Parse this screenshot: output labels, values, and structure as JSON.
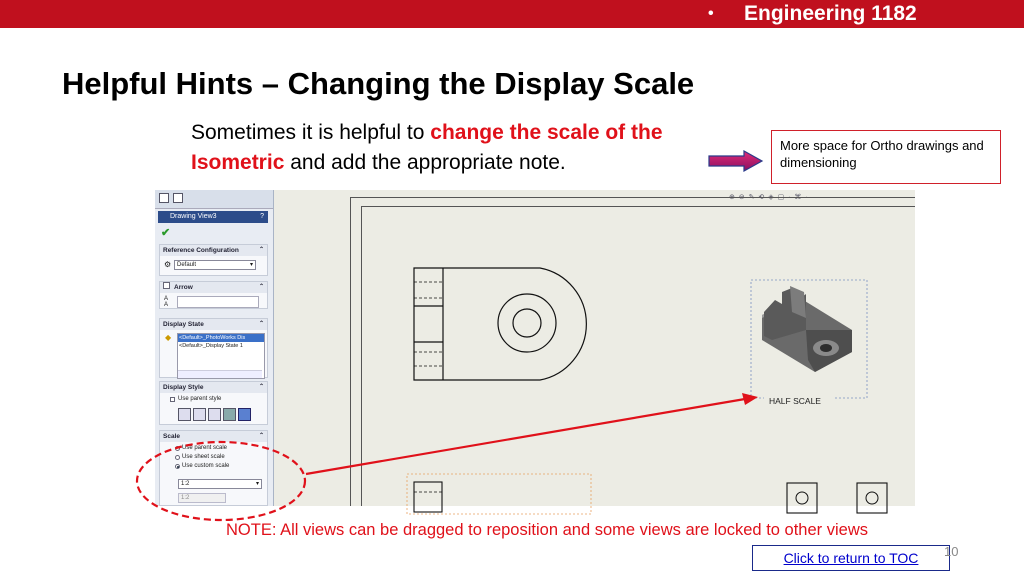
{
  "header": {
    "bullet": "•",
    "course": "Engineering 1182"
  },
  "slide": {
    "title": "Helpful Hints – Changing the Display Scale",
    "intro_part1": "Sometimes it is helpful to ",
    "intro_highlight": "change the scale of the Isometric",
    "intro_part2": " and add the appropriate note.",
    "callout": "More space for Ortho drawings and dimensioning",
    "note": "NOTE: All views can be dragged to reposition and some views are locked to other views",
    "toc_link": "Click to return to TOC",
    "page_number": "10"
  },
  "property_manager": {
    "title": "Drawing View3",
    "help": "?",
    "reference_config": {
      "label": "Reference Configuration",
      "value": "Default"
    },
    "arrow": {
      "label": "Arrow"
    },
    "display_state": {
      "label": "Display State",
      "items": [
        "<Default>_PhotoWorks Dis",
        "<Default>_Display State 1"
      ]
    },
    "display_style": {
      "label": "Display Style",
      "use_parent": "Use parent style"
    },
    "scale": {
      "label": "Scale",
      "options": [
        "Use parent scale",
        "Use sheet scale",
        "Use custom scale"
      ],
      "selected_value": "1:2",
      "custom_value": "1:2"
    }
  },
  "drawing": {
    "iso_label": "HALF SCALE"
  },
  "colors": {
    "header_bg": "#c0101e",
    "accent_red": "#e0111a",
    "link": "#0000cc"
  }
}
